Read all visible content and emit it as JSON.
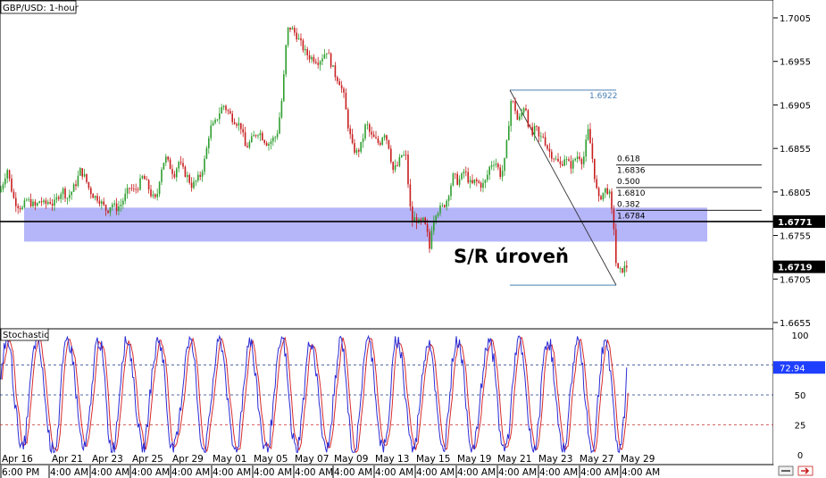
{
  "chart_data": [
    {
      "type": "candlestick",
      "title": "GBP/USD: 1-hour",
      "ylim": [
        1.6635,
        1.7035
      ],
      "y_ticks": [
        "1.7005",
        "1.6955",
        "1.6905",
        "1.6855",
        "1.6805",
        "1.6755",
        "1.6705",
        "1.6655"
      ],
      "y_tick_values": [
        1.7005,
        1.6955,
        1.6905,
        1.6855,
        1.6805,
        1.6755,
        1.6705,
        1.6655
      ],
      "current_price": "1.6719",
      "horizontal_line": {
        "value": 1.6771,
        "label": "1.6771"
      },
      "annotation": "S/R úroveň",
      "sr_zone": [
        1.6748,
        1.6787
      ],
      "x_date_labels": [
        "Apr 16",
        "Apr 21",
        "Apr 23",
        "Apr 25",
        "Apr 29",
        "May 01",
        "May 05",
        "May 07",
        "May 09",
        "May 13",
        "May 15",
        "May 19",
        "May 21",
        "May 23",
        "May 27",
        "May 29"
      ],
      "x_time_labels": [
        "6:00 PM",
        "4:00 AM",
        "4:00 AM",
        "4:00 AM",
        "4:00 AM",
        "4:00 AM",
        "4:00 AM",
        "4:00 AM",
        "4:00 AM",
        "4:00 AM",
        "4:00 AM",
        "4:00 AM",
        "4:00 AM",
        "4:00 AM",
        "4:00 AM",
        "4:00 AM"
      ],
      "price_path": [
        [
          0,
          1.6805
        ],
        [
          4,
          1.6818
        ],
        [
          8,
          1.6832
        ],
        [
          12,
          1.6812
        ],
        [
          16,
          1.6795
        ],
        [
          20,
          1.679
        ],
        [
          25,
          1.6786
        ],
        [
          30,
          1.6796
        ],
        [
          35,
          1.6792
        ],
        [
          40,
          1.6788
        ],
        [
          45,
          1.6796
        ],
        [
          50,
          1.679
        ],
        [
          55,
          1.6795
        ],
        [
          60,
          1.679
        ],
        [
          65,
          1.68
        ],
        [
          70,
          1.6808
        ],
        [
          75,
          1.6798
        ],
        [
          80,
          1.6805
        ],
        [
          85,
          1.6815
        ],
        [
          90,
          1.683
        ],
        [
          95,
          1.6822
        ],
        [
          100,
          1.6808
        ],
        [
          105,
          1.68
        ],
        [
          110,
          1.6798
        ],
        [
          115,
          1.679
        ],
        [
          120,
          1.6783
        ],
        [
          125,
          1.6792
        ],
        [
          130,
          1.6786
        ],
        [
          135,
          1.679
        ],
        [
          140,
          1.68
        ],
        [
          145,
          1.681
        ],
        [
          150,
          1.6806
        ],
        [
          155,
          1.6812
        ],
        [
          160,
          1.6823
        ],
        [
          165,
          1.6813
        ],
        [
          170,
          1.68
        ],
        [
          175,
          1.6795
        ],
        [
          180,
          1.683
        ],
        [
          185,
          1.6845
        ],
        [
          190,
          1.6835
        ],
        [
          195,
          1.6825
        ],
        [
          200,
          1.684
        ],
        [
          205,
          1.683
        ],
        [
          210,
          1.6822
        ],
        [
          215,
          1.6812
        ],
        [
          220,
          1.6818
        ],
        [
          225,
          1.6825
        ],
        [
          230,
          1.6845
        ],
        [
          235,
          1.6878
        ],
        [
          240,
          1.6882
        ],
        [
          245,
          1.6895
        ],
        [
          250,
          1.6905
        ],
        [
          255,
          1.6898
        ],
        [
          260,
          1.689
        ],
        [
          265,
          1.6885
        ],
        [
          270,
          1.688
        ],
        [
          275,
          1.6855
        ],
        [
          280,
          1.6862
        ],
        [
          285,
          1.687
        ],
        [
          290,
          1.6875
        ],
        [
          295,
          1.6866
        ],
        [
          300,
          1.686
        ],
        [
          305,
          1.6865
        ],
        [
          310,
          1.687
        ],
        [
          315,
          1.6905
        ],
        [
          318,
          1.694
        ],
        [
          320,
          1.697
        ],
        [
          323,
          1.6995
        ],
        [
          327,
          1.6992
        ],
        [
          332,
          1.6985
        ],
        [
          337,
          1.6975
        ],
        [
          342,
          1.6965
        ],
        [
          347,
          1.696
        ],
        [
          352,
          1.6958
        ],
        [
          357,
          1.6955
        ],
        [
          362,
          1.6962
        ],
        [
          366,
          1.6968
        ],
        [
          370,
          1.6955
        ],
        [
          375,
          1.694
        ],
        [
          380,
          1.6932
        ],
        [
          385,
          1.6915
        ],
        [
          390,
          1.688
        ],
        [
          395,
          1.6855
        ],
        [
          400,
          1.685
        ],
        [
          405,
          1.686
        ],
        [
          410,
          1.6885
        ],
        [
          415,
          1.687
        ],
        [
          420,
          1.6865
        ],
        [
          425,
          1.686
        ],
        [
          430,
          1.6875
        ],
        [
          435,
          1.686
        ],
        [
          440,
          1.683
        ],
        [
          445,
          1.6835
        ],
        [
          450,
          1.6848
        ],
        [
          455,
          1.6845
        ],
        [
          458,
          1.68
        ],
        [
          461,
          1.677
        ],
        [
          465,
          1.6775
        ],
        [
          470,
          1.6768
        ],
        [
          474,
          1.6772
        ],
        [
          478,
          1.676
        ],
        [
          481,
          1.674
        ],
        [
          484,
          1.677
        ],
        [
          488,
          1.6782
        ],
        [
          492,
          1.6785
        ],
        [
          496,
          1.6788
        ],
        [
          500,
          1.6795
        ],
        [
          504,
          1.681
        ],
        [
          508,
          1.6825
        ],
        [
          512,
          1.6817
        ],
        [
          516,
          1.682
        ],
        [
          520,
          1.683
        ],
        [
          524,
          1.682
        ],
        [
          528,
          1.6812
        ],
        [
          532,
          1.6818
        ],
        [
          536,
          1.6815
        ],
        [
          540,
          1.6812
        ],
        [
          544,
          1.6818
        ],
        [
          548,
          1.6833
        ],
        [
          552,
          1.684
        ],
        [
          556,
          1.6838
        ],
        [
          560,
          1.6825
        ],
        [
          564,
          1.6832
        ],
        [
          568,
          1.6865
        ],
        [
          572,
          1.691
        ],
        [
          576,
          1.6905
        ],
        [
          580,
          1.6885
        ],
        [
          584,
          1.6895
        ],
        [
          588,
          1.6908
        ],
        [
          592,
          1.688
        ],
        [
          596,
          1.687
        ],
        [
          600,
          1.688
        ],
        [
          604,
          1.6865
        ],
        [
          608,
          1.687
        ],
        [
          612,
          1.6858
        ],
        [
          616,
          1.685
        ],
        [
          620,
          1.6845
        ],
        [
          624,
          1.684
        ],
        [
          628,
          1.6835
        ],
        [
          632,
          1.6845
        ],
        [
          636,
          1.6838
        ],
        [
          640,
          1.6835
        ],
        [
          644,
          1.6843
        ],
        [
          648,
          1.6848
        ],
        [
          652,
          1.684
        ],
        [
          655,
          1.685
        ],
        [
          658,
          1.6878
        ],
        [
          662,
          1.6855
        ],
        [
          666,
          1.6822
        ],
        [
          670,
          1.6795
        ],
        [
          674,
          1.6802
        ],
        [
          678,
          1.6808
        ],
        [
          682,
          1.6806
        ],
        [
          685,
          1.6782
        ],
        [
          688,
          1.676
        ],
        [
          690,
          1.672
        ],
        [
          693,
          1.6712
        ],
        [
          697,
          1.6716
        ],
        [
          701,
          1.6719
        ],
        [
          705,
          1.6722
        ]
      ]
    },
    {
      "type": "line",
      "title": "Stochastic",
      "ylim": [
        0,
        100
      ],
      "y_ticks": [
        "100",
        "75",
        "50",
        "25",
        "0"
      ],
      "y_tick_values": [
        100,
        75,
        50,
        25,
        0
      ],
      "levels": [
        75,
        50,
        25
      ],
      "current_value": "72.94",
      "series": [
        {
          "color": "#2b2bd6"
        },
        {
          "color": "#d62b2b"
        }
      ]
    }
  ],
  "fib": {
    "high_label": "1.6922",
    "high": 1.6922,
    "low": 1.6698,
    "levels": [
      {
        "ratio": "0.618",
        "price": "1.6836",
        "value": 1.6836
      },
      {
        "ratio": "0.500",
        "price": "1.6810",
        "value": 1.681
      },
      {
        "ratio": "0.382",
        "price": "1.6784",
        "value": 1.6784
      }
    ]
  },
  "colors": {
    "bull": "#2e9e2e",
    "bear": "#c81e1e",
    "zone": "#a8a8f8",
    "fib": "#4a7fb5",
    "stoch_k": "#2b2bd6",
    "stoch_d": "#d62b2b",
    "badge": "#1f3fff",
    "level_line": "#1e90ff",
    "guide": "#cc3333"
  },
  "icons": [
    "scroll-icon",
    "close-icon"
  ]
}
